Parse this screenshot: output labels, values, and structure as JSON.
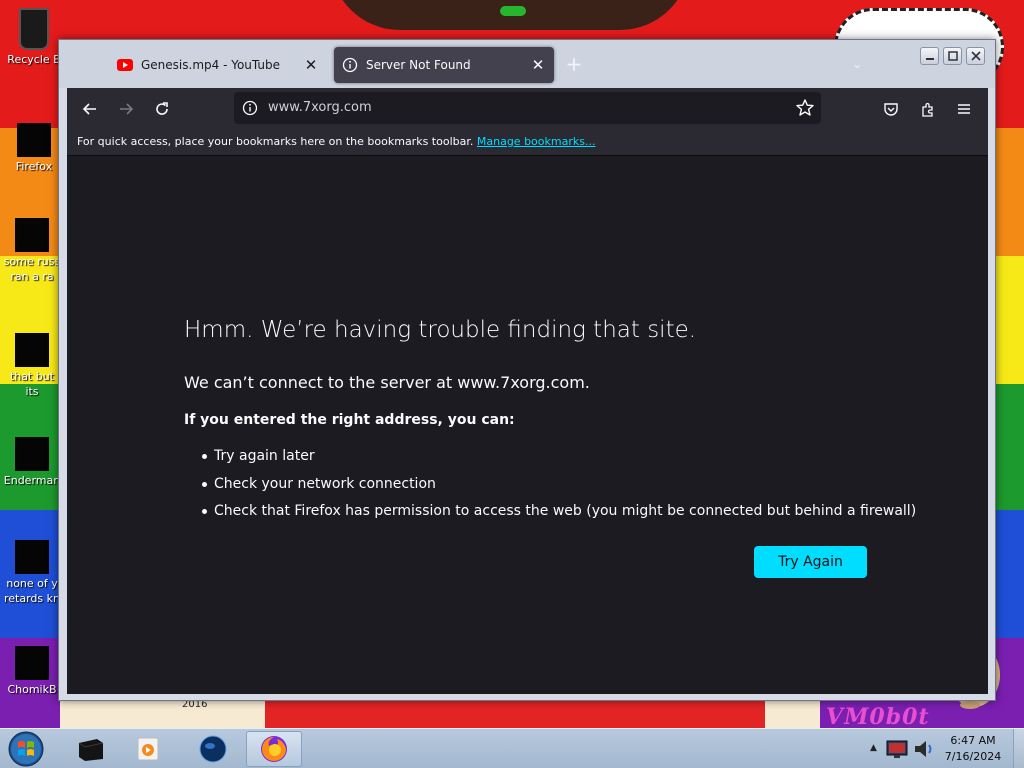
{
  "desktop": {
    "icons": [
      {
        "label": "Recycle B"
      },
      {
        "label": "Firefox"
      },
      {
        "label": "some russ",
        "label2": "ran a ra"
      },
      {
        "label": "that but its"
      },
      {
        "label": "Enderman"
      },
      {
        "label": "none of y",
        "label2": "retards kn"
      },
      {
        "label": "ChomikB"
      }
    ],
    "year_text": "2016",
    "watermark": "VM0b0t"
  },
  "browser": {
    "tabs": [
      {
        "label": "Genesis.mp4 - YouTube",
        "icon": "youtube-icon",
        "active": false
      },
      {
        "label": "Server Not Found",
        "icon": "info-icon",
        "active": true
      }
    ],
    "new_tab": "+",
    "url": "www.7xorg.com",
    "bookmarks_bar": {
      "text": "For quick access, place your bookmarks here on the bookmarks toolbar.",
      "link": "Manage bookmarks..."
    },
    "error": {
      "title": "Hmm. We’re having trouble finding that site.",
      "message": "We can’t connect to the server at www.7xorg.com.",
      "subtitle": "If you entered the right address, you can:",
      "suggestions": [
        "Try again later",
        "Check your network connection",
        "Check that Firefox has permission to access the web (you might be connected but behind a firewall)"
      ],
      "button": "Try Again"
    },
    "colors": {
      "accent": "#00ddff",
      "page_bg": "#1c1b22",
      "toolbar_bg": "#2b2a33"
    }
  },
  "taskbar": {
    "time": "6:47 AM",
    "date": "7/16/2024"
  }
}
